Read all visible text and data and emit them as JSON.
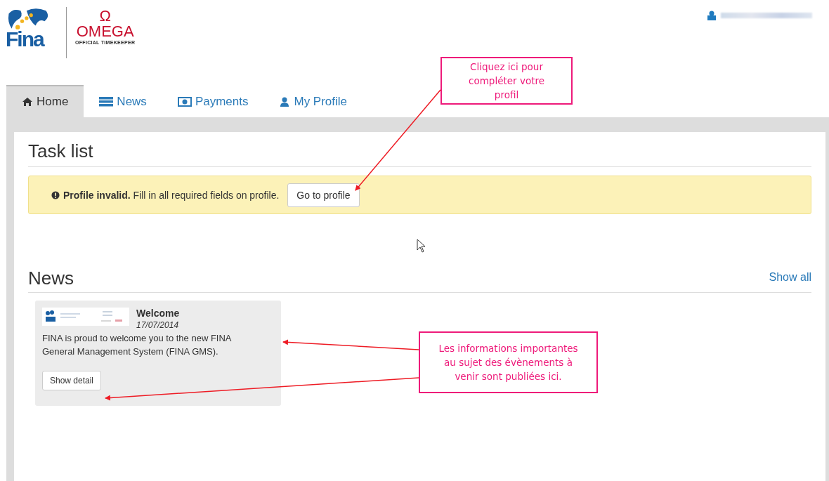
{
  "logos": {
    "fina": "Fina",
    "omega_symbol": "Ω",
    "omega": "OMEGA",
    "omega_sub": "OFFICIAL TIMEKEEPER"
  },
  "tabs": [
    {
      "label": "Home",
      "selected": true
    },
    {
      "label": "News",
      "selected": false
    },
    {
      "label": "Payments",
      "selected": false
    },
    {
      "label": "My Profile",
      "selected": false
    }
  ],
  "task_list": {
    "title": "Task list",
    "alert": {
      "strong": "Profile invalid.",
      "text": "Fill in all required fields on profile.",
      "button": "Go to profile"
    }
  },
  "news": {
    "title": "News",
    "show_all": "Show all",
    "items": [
      {
        "title": "Welcome",
        "date": "17/07/2014",
        "body": "FINA is proud to welcome you to the new FINA General Management System (FINA GMS).",
        "button": "Show detail"
      }
    ]
  },
  "callouts": [
    "Cliquez ici pour compléter votre profil",
    "Les informations importantes au sujet des évènements à venir sont publiées ici."
  ]
}
